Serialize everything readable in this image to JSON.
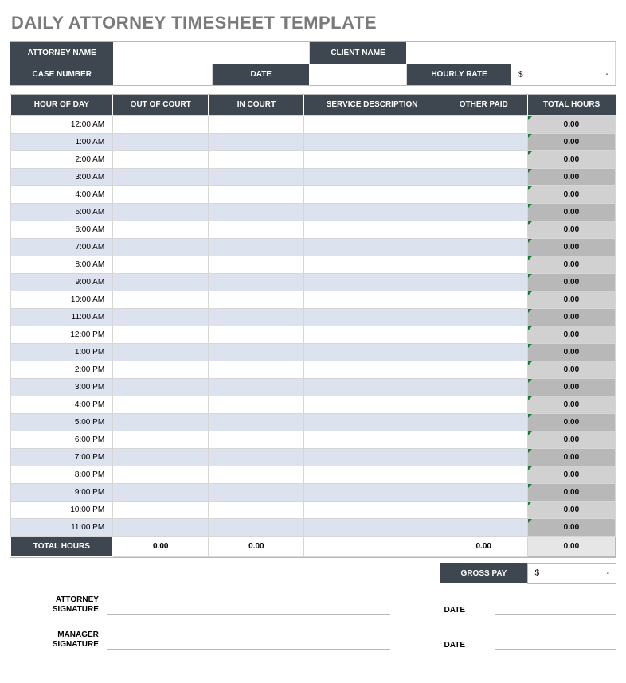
{
  "title": "DAILY ATTORNEY TIMESHEET TEMPLATE",
  "info": {
    "attorney_name_label": "ATTORNEY NAME",
    "attorney_name_value": "",
    "client_name_label": "CLIENT NAME",
    "client_name_value": "",
    "case_number_label": "CASE NUMBER",
    "case_number_value": "",
    "date_label": "DATE",
    "date_value": "",
    "hourly_rate_label": "HOURLY RATE",
    "hourly_rate_symbol": "$",
    "hourly_rate_value": "-"
  },
  "grid": {
    "headers": {
      "hour_of_day": "HOUR OF DAY",
      "out_of_court": "OUT OF COURT",
      "in_court": "IN COURT",
      "service_description": "SERVICE DESCRIPTION",
      "other_paid": "OTHER PAID",
      "total_hours": "TOTAL HOURS"
    },
    "rows": [
      {
        "hour": "12:00 AM",
        "out": "",
        "in": "",
        "desc": "",
        "other": "",
        "total": "0.00"
      },
      {
        "hour": "1:00 AM",
        "out": "",
        "in": "",
        "desc": "",
        "other": "",
        "total": "0.00"
      },
      {
        "hour": "2:00 AM",
        "out": "",
        "in": "",
        "desc": "",
        "other": "",
        "total": "0.00"
      },
      {
        "hour": "3:00 AM",
        "out": "",
        "in": "",
        "desc": "",
        "other": "",
        "total": "0.00"
      },
      {
        "hour": "4:00 AM",
        "out": "",
        "in": "",
        "desc": "",
        "other": "",
        "total": "0.00"
      },
      {
        "hour": "5:00 AM",
        "out": "",
        "in": "",
        "desc": "",
        "other": "",
        "total": "0.00"
      },
      {
        "hour": "6:00 AM",
        "out": "",
        "in": "",
        "desc": "",
        "other": "",
        "total": "0.00"
      },
      {
        "hour": "7:00 AM",
        "out": "",
        "in": "",
        "desc": "",
        "other": "",
        "total": "0.00"
      },
      {
        "hour": "8:00 AM",
        "out": "",
        "in": "",
        "desc": "",
        "other": "",
        "total": "0.00"
      },
      {
        "hour": "9:00 AM",
        "out": "",
        "in": "",
        "desc": "",
        "other": "",
        "total": "0.00"
      },
      {
        "hour": "10:00 AM",
        "out": "",
        "in": "",
        "desc": "",
        "other": "",
        "total": "0.00"
      },
      {
        "hour": "11:00 AM",
        "out": "",
        "in": "",
        "desc": "",
        "other": "",
        "total": "0.00"
      },
      {
        "hour": "12:00 PM",
        "out": "",
        "in": "",
        "desc": "",
        "other": "",
        "total": "0.00"
      },
      {
        "hour": "1:00 PM",
        "out": "",
        "in": "",
        "desc": "",
        "other": "",
        "total": "0.00"
      },
      {
        "hour": "2:00 PM",
        "out": "",
        "in": "",
        "desc": "",
        "other": "",
        "total": "0.00"
      },
      {
        "hour": "3:00 PM",
        "out": "",
        "in": "",
        "desc": "",
        "other": "",
        "total": "0.00"
      },
      {
        "hour": "4:00 PM",
        "out": "",
        "in": "",
        "desc": "",
        "other": "",
        "total": "0.00"
      },
      {
        "hour": "5:00 PM",
        "out": "",
        "in": "",
        "desc": "",
        "other": "",
        "total": "0.00"
      },
      {
        "hour": "6:00 PM",
        "out": "",
        "in": "",
        "desc": "",
        "other": "",
        "total": "0.00"
      },
      {
        "hour": "7:00 PM",
        "out": "",
        "in": "",
        "desc": "",
        "other": "",
        "total": "0.00"
      },
      {
        "hour": "8:00 PM",
        "out": "",
        "in": "",
        "desc": "",
        "other": "",
        "total": "0.00"
      },
      {
        "hour": "9:00 PM",
        "out": "",
        "in": "",
        "desc": "",
        "other": "",
        "total": "0.00"
      },
      {
        "hour": "10:00 PM",
        "out": "",
        "in": "",
        "desc": "",
        "other": "",
        "total": "0.00"
      },
      {
        "hour": "11:00 PM",
        "out": "",
        "in": "",
        "desc": "",
        "other": "",
        "total": "0.00"
      }
    ],
    "footer": {
      "label": "TOTAL HOURS",
      "out": "0.00",
      "in": "0.00",
      "desc": "",
      "other": "0.00",
      "total": "0.00"
    }
  },
  "gross": {
    "label": "GROSS PAY",
    "symbol": "$",
    "value": "-"
  },
  "signatures": {
    "attorney_label_l1": "ATTORNEY",
    "attorney_label_l2": "SIGNATURE",
    "manager_label_l1": "MANAGER",
    "manager_label_l2": "SIGNATURE",
    "date_label": "DATE"
  }
}
